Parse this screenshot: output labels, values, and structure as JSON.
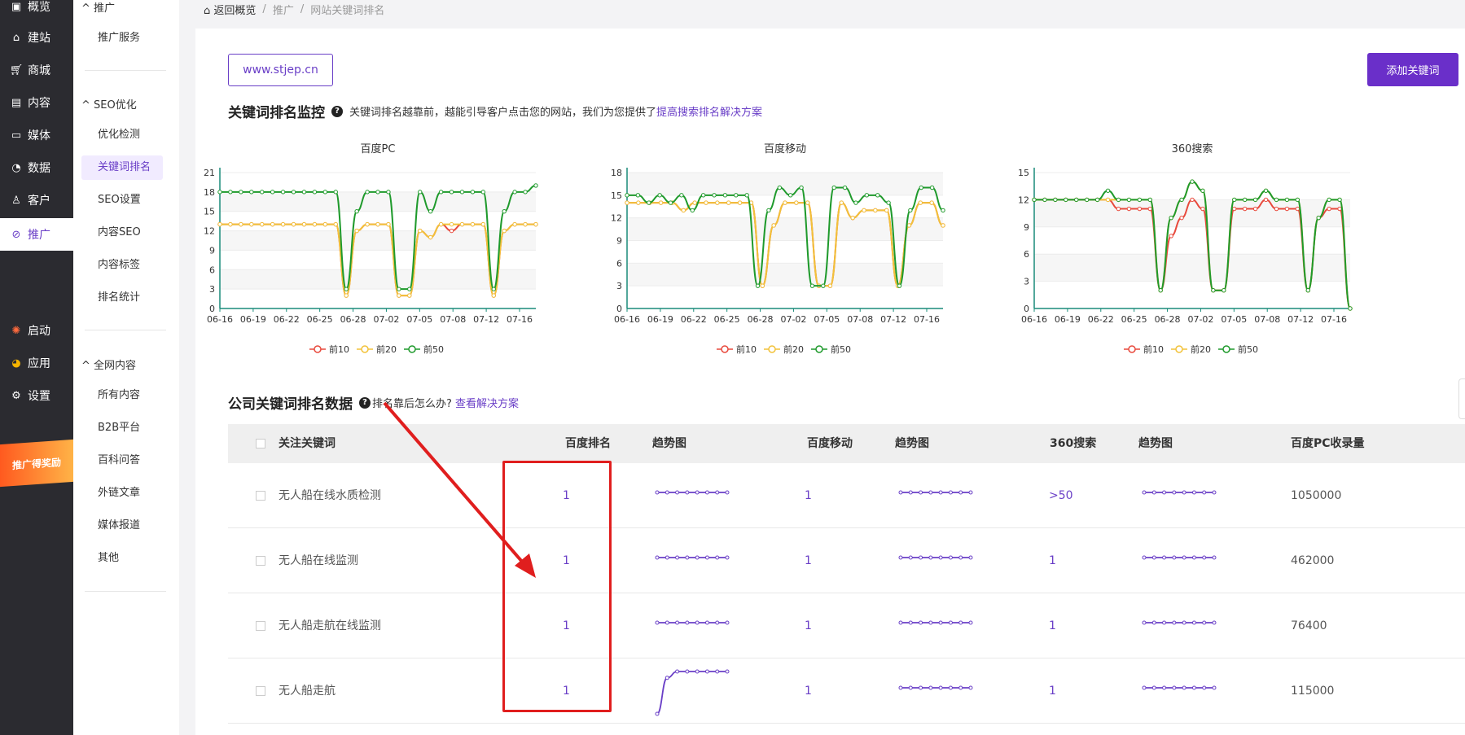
{
  "leftnav": {
    "items": [
      {
        "label": "概览",
        "icon": "overview-icon"
      },
      {
        "label": "建站",
        "icon": "home-icon"
      },
      {
        "label": "商城",
        "icon": "cart-icon"
      },
      {
        "label": "内容",
        "icon": "document-icon"
      },
      {
        "label": "媒体",
        "icon": "video-icon"
      },
      {
        "label": "数据",
        "icon": "pie-chart-icon"
      },
      {
        "label": "客户",
        "icon": "user-icon"
      },
      {
        "label": "推广",
        "icon": "paperclip-icon",
        "active": true
      }
    ],
    "bottom_items": [
      {
        "label": "启动",
        "icon": "launch-icon"
      },
      {
        "label": "应用",
        "icon": "apps-icon"
      },
      {
        "label": "设置",
        "icon": "gear-icon"
      }
    ],
    "promo_label": "推广得奖励"
  },
  "subnav": {
    "groups": [
      {
        "title": "推广",
        "items": [
          "推广服务"
        ]
      },
      {
        "title": "SEO优化",
        "items": [
          "优化检测",
          "关键词排名",
          "SEO设置",
          "内容SEO",
          "内容标签",
          "排名统计"
        ]
      },
      {
        "title": "全网内容",
        "items": [
          "所有内容",
          "B2B平台",
          "百科问答",
          "外链文章",
          "媒体报道",
          "其他"
        ]
      }
    ],
    "active_item": "关键词排名"
  },
  "breadcrumb": {
    "home": "返回概览",
    "level1": "推广",
    "level2": "网站关键词排名"
  },
  "toolbar": {
    "domain": "www.stjep.cn",
    "add_keyword": "添加关键词"
  },
  "monitor": {
    "title": "关键词排名监控",
    "desc": "关键词排名越靠前，越能引导客户点击您的网站，我们为您提供了",
    "link": "提高搜索排名解决方案"
  },
  "legend": [
    "前10",
    "前20",
    "前50"
  ],
  "colors": {
    "top10": "#e8493c",
    "top20": "#f2c23a",
    "top50": "#1f9a2c",
    "accent": "#6a3fc7",
    "axis": "#1a8c7a"
  },
  "chart_data": [
    {
      "type": "line",
      "title": "百度PC",
      "x_ticks": [
        "06-16",
        "06-19",
        "06-22",
        "06-25",
        "06-28",
        "07-02",
        "07-05",
        "07-08",
        "07-12",
        "07-16"
      ],
      "ylim": [
        0,
        21
      ],
      "y_ticks": [
        0,
        3,
        6,
        9,
        12,
        15,
        18,
        21
      ],
      "series": [
        {
          "name": "前10",
          "values": [
            13,
            13,
            13,
            13,
            13,
            13,
            13,
            13,
            13,
            13,
            13,
            13,
            2,
            12,
            13,
            13,
            13,
            2,
            2,
            12,
            11,
            13,
            12,
            13,
            13,
            13,
            2,
            12,
            13,
            13,
            13
          ]
        },
        {
          "name": "前20",
          "values": [
            13,
            13,
            13,
            13,
            13,
            13,
            13,
            13,
            13,
            13,
            13,
            13,
            2,
            12,
            13,
            13,
            13,
            2,
            2,
            12,
            11,
            13,
            13,
            13,
            13,
            13,
            2,
            12,
            13,
            13,
            13
          ]
        },
        {
          "name": "前50",
          "values": [
            18,
            18,
            18,
            18,
            18,
            18,
            18,
            18,
            18,
            18,
            18,
            18,
            3,
            15,
            18,
            18,
            18,
            3,
            3,
            18,
            15,
            18,
            18,
            18,
            18,
            18,
            3,
            15,
            18,
            18,
            19
          ]
        }
      ]
    },
    {
      "type": "line",
      "title": "百度移动",
      "x_ticks": [
        "06-16",
        "06-19",
        "06-22",
        "06-25",
        "06-28",
        "07-02",
        "07-05",
        "07-08",
        "07-12",
        "07-16"
      ],
      "ylim": [
        0,
        18
      ],
      "y_ticks": [
        0,
        3,
        6,
        9,
        12,
        15,
        18
      ],
      "series": [
        {
          "name": "前10",
          "values": [
            14,
            14,
            14,
            14,
            14,
            13,
            14,
            14,
            14,
            14,
            14,
            14,
            3,
            11,
            14,
            14,
            14,
            3,
            3,
            14,
            12,
            13,
            13,
            13,
            3,
            11,
            14,
            14,
            11
          ]
        },
        {
          "name": "前20",
          "values": [
            14,
            14,
            14,
            14,
            14,
            13,
            14,
            14,
            14,
            14,
            14,
            14,
            3,
            11,
            14,
            14,
            14,
            3,
            3,
            14,
            12,
            13,
            13,
            13,
            3,
            11,
            14,
            14,
            11
          ]
        },
        {
          "name": "前50",
          "values": [
            15,
            15,
            14,
            15,
            14,
            15,
            13,
            15,
            15,
            15,
            15,
            15,
            3,
            13,
            16,
            15,
            16,
            3,
            3,
            16,
            16,
            14,
            15,
            15,
            14,
            3,
            13,
            16,
            16,
            13
          ]
        }
      ]
    },
    {
      "type": "line",
      "title": "360搜索",
      "x_ticks": [
        "06-16",
        "06-19",
        "06-22",
        "06-25",
        "06-28",
        "07-02",
        "07-05",
        "07-08",
        "07-12",
        "07-16"
      ],
      "ylim": [
        0,
        15
      ],
      "y_ticks": [
        0,
        3,
        6,
        9,
        12,
        15
      ],
      "series": [
        {
          "name": "前10",
          "values": [
            12,
            12,
            12,
            12,
            12,
            12,
            12,
            12,
            11,
            11,
            11,
            11,
            2,
            8,
            10,
            12,
            11,
            2,
            2,
            11,
            11,
            11,
            12,
            11,
            11,
            11,
            2,
            10,
            11,
            11,
            0
          ]
        },
        {
          "name": "前20",
          "values": [
            12,
            12,
            12,
            12,
            12,
            12,
            12,
            12,
            12,
            12,
            12,
            12,
            2,
            10,
            12,
            14,
            13,
            2,
            2,
            12,
            12,
            12,
            13,
            12,
            12,
            12,
            2,
            10,
            12,
            12,
            0
          ]
        },
        {
          "name": "前50",
          "values": [
            12,
            12,
            12,
            12,
            12,
            12,
            12,
            13,
            12,
            12,
            12,
            12,
            2,
            10,
            12,
            14,
            13,
            2,
            2,
            12,
            12,
            12,
            13,
            12,
            12,
            12,
            2,
            10,
            12,
            12,
            0
          ]
        }
      ]
    }
  ],
  "company": {
    "title": "公司关键词排名数据",
    "desc": "排名靠后怎么办?",
    "link": "查看解决方案"
  },
  "table": {
    "headers": [
      "关注关键词",
      "百度排名",
      "趋势图",
      "百度移动",
      "趋势图",
      "360搜索",
      "趋势图",
      "百度PC收录量"
    ],
    "rows": [
      {
        "keyword": "无人船在线水质检测",
        "baidu": "1",
        "mobile": "1",
        "s360": ">50",
        "count": "1050000",
        "trend_baidu": [
          1,
          1,
          1,
          1,
          1,
          1,
          1,
          1
        ],
        "trend_mobile": [
          1,
          1,
          1,
          1,
          1,
          1,
          1,
          1
        ],
        "trend_360": [
          1,
          1,
          1,
          1,
          1,
          1,
          1,
          1
        ]
      },
      {
        "keyword": "无人船在线监测",
        "baidu": "1",
        "mobile": "1",
        "s360": "1",
        "count": "462000",
        "trend_baidu": [
          1,
          1,
          1,
          1,
          1,
          1,
          1,
          1
        ],
        "trend_mobile": [
          1,
          1,
          1,
          1,
          1,
          1,
          1,
          1
        ],
        "trend_360": [
          1,
          1,
          1,
          1,
          1,
          1,
          1,
          1
        ]
      },
      {
        "keyword": "无人船走航在线监测",
        "baidu": "1",
        "mobile": "1",
        "s360": "1",
        "count": "76400",
        "trend_baidu": [
          1,
          1,
          1,
          1,
          1,
          1,
          1,
          1
        ],
        "trend_mobile": [
          1,
          1,
          1,
          1,
          1,
          1,
          1,
          1
        ],
        "trend_360": [
          1,
          1,
          1,
          1,
          1,
          1,
          1,
          1
        ]
      },
      {
        "keyword": "无人船走航",
        "baidu": "1",
        "mobile": "1",
        "s360": "1",
        "count": "115000",
        "trend_baidu": [
          0,
          0.85,
          1,
          1,
          1,
          1,
          1,
          1
        ],
        "trend_mobile": [
          1,
          1,
          1,
          1,
          1,
          1,
          1,
          1
        ],
        "trend_360": [
          1,
          1,
          1,
          1,
          1,
          1,
          1,
          1
        ]
      }
    ]
  }
}
